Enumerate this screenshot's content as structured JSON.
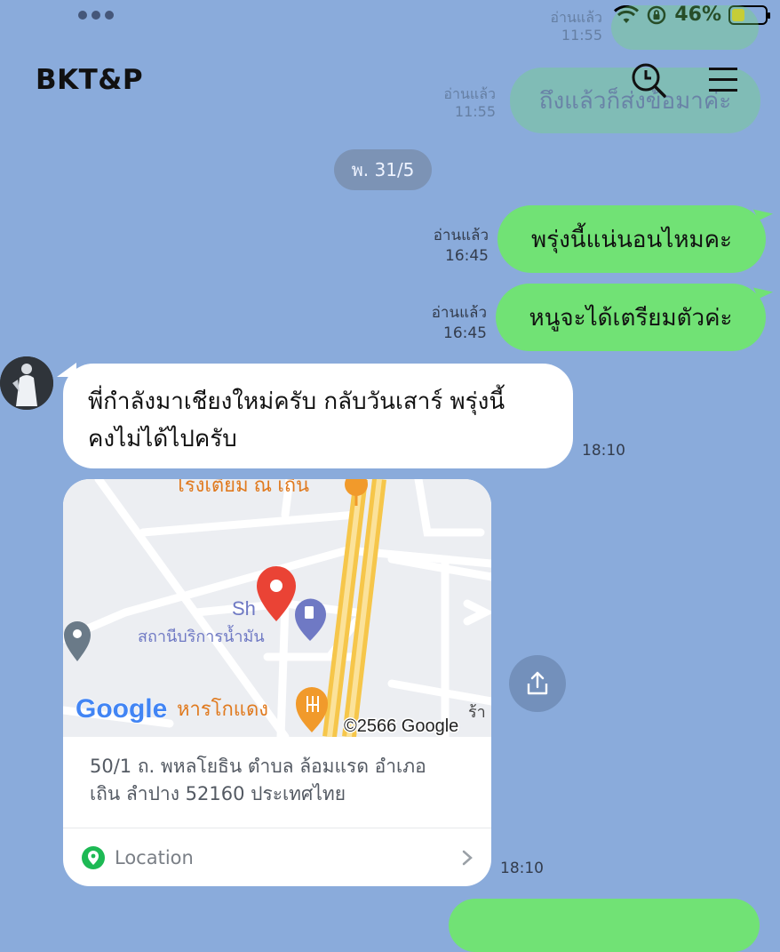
{
  "status_bar": {
    "battery_text": "46%",
    "battery_color": "#f5c518"
  },
  "header": {
    "title": "BKT&P",
    "search_icon": "search-icon",
    "menu_icon": "hamburger-menu-icon"
  },
  "ghost": {
    "read_label_1": "อ่านแล้ว",
    "time_1": "11:55",
    "read_label_2": "อ่านแล้ว",
    "time_2": "11:55",
    "bubble_text": "ถึงแล้วก็ส่งข้อมาค่ะ"
  },
  "date_divider": "พ. 31/5",
  "messages": [
    {
      "side": "out",
      "text": "พรุ่งนี้แน่นอนไหมคะ",
      "read": "อ่านแล้ว",
      "time": "16:45"
    },
    {
      "side": "out",
      "text": "หนูจะได้เตรียมตัวค่ะ",
      "read": "อ่านแล้ว",
      "time": "16:45"
    },
    {
      "side": "in",
      "line1": "พี่กำลังมาเชียงใหม่ครับ กลับวันเสาร์ พรุ่งนี้",
      "line2": "คงไม่ได้ไปครับ",
      "time": "18:10"
    }
  ],
  "location": {
    "map_labels": {
      "top_poi": "โรงเตียม ณ เถิน",
      "gas_station": "สถานีบริการน้ำมัน",
      "shell": "Sh",
      "restaurant": "หารโกแดง",
      "right_edge": "ร้า",
      "google_logo": "Google",
      "copyright": "©2566 Google"
    },
    "address_line1": "50/1 ถ. พหลโยธิน ตำบล ล้อมแรด อำเภอ",
    "address_line2": "เถิน ลำปาง 52160 ประเทศไทย",
    "label": "Location",
    "time": "18:10"
  },
  "colors": {
    "background": "#8aabdb",
    "outgoing_bubble": "#71e275",
    "incoming_bubble": "#ffffff",
    "share_button": "#7390bb"
  }
}
